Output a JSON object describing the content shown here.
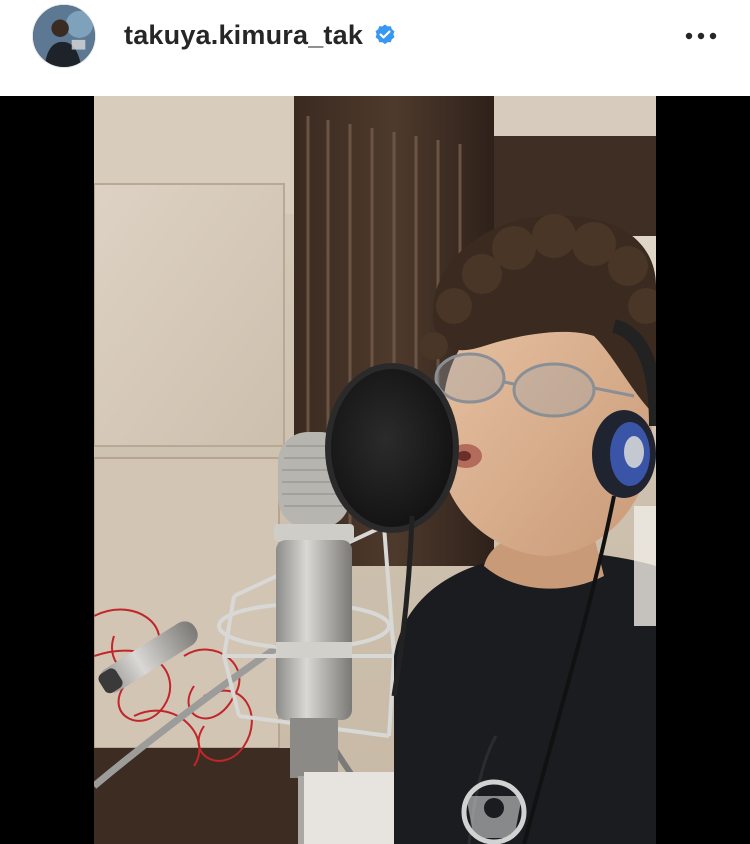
{
  "post": {
    "username": "takuya.kimura_tak",
    "verified": true,
    "more_icon": "more-horizontal-icon",
    "avatar_icon": "profile-avatar",
    "media_description_icon": "recording-studio-selfie-photo"
  },
  "colors": {
    "header_bg": "#ffffff",
    "text": "#262626",
    "verified_blue": "#3897f0",
    "media_letterbox": "#000000"
  }
}
